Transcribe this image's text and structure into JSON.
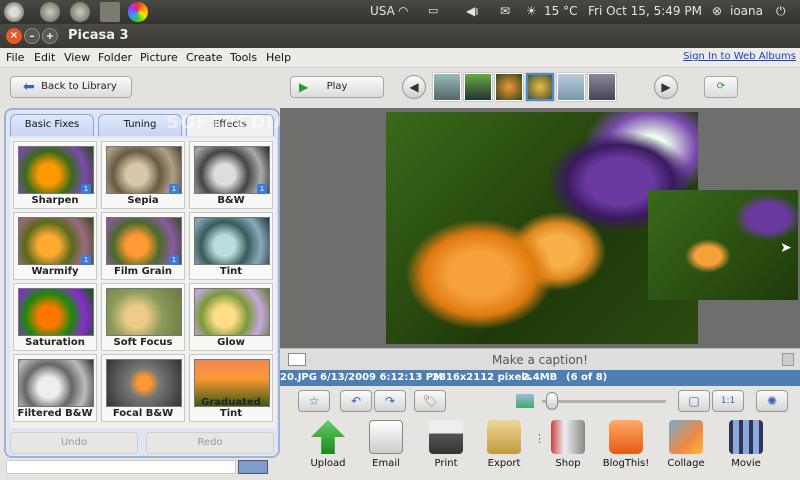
{
  "topbar": {
    "lang": "USA",
    "temp": "15 °C",
    "datetime": "Fri Oct 15,  5:49 PM",
    "user": "ioana"
  },
  "window": {
    "title": "Picasa 3"
  },
  "menu": {
    "items": [
      "File",
      "Edit",
      "View",
      "Folder",
      "Picture",
      "Create",
      "Tools",
      "Help"
    ],
    "signin": "Sign In to Web Albums"
  },
  "toolbar": {
    "back_label": "Back to Library",
    "play_label": "Play"
  },
  "tabs": {
    "basic": "Basic Fixes",
    "tuning": "Tuning",
    "effects": "Effects"
  },
  "watermark": "SOFTPEDIA",
  "effects": [
    {
      "label": "Sharpen",
      "badge": "1"
    },
    {
      "label": "Sepia",
      "badge": "1"
    },
    {
      "label": "B&W",
      "badge": "1"
    },
    {
      "label": "Warmify",
      "badge": "1"
    },
    {
      "label": "Film Grain",
      "badge": "1"
    },
    {
      "label": "Tint",
      "badge": ""
    },
    {
      "label": "Saturation",
      "badge": ""
    },
    {
      "label": "Soft Focus",
      "badge": ""
    },
    {
      "label": "Glow",
      "badge": ""
    },
    {
      "label": "Filtered B&W",
      "badge": ""
    },
    {
      "label": "Focal B&W",
      "badge": ""
    },
    {
      "label": "Graduated Tint",
      "badge": ""
    }
  ],
  "undo_label": "Undo",
  "redo_label": "Redo",
  "caption_placeholder": "Make a caption!",
  "info": {
    "filename": "20.JPG",
    "date": "6/13/2009 6:12:13 PM",
    "dimensions": "2816x2112 pixels",
    "size": "2.4MB",
    "position": "(6 of 8)"
  },
  "zoom_label": "1:1",
  "actions": [
    {
      "label": "Upload",
      "icon": "upload-icon"
    },
    {
      "label": "Email",
      "icon": "email-icon"
    },
    {
      "label": "Print",
      "icon": "print-icon"
    },
    {
      "label": "Export",
      "icon": "export-icon"
    },
    {
      "label": "Shop",
      "icon": "shop-icon"
    },
    {
      "label": "BlogThis!",
      "icon": "blogger-icon"
    },
    {
      "label": "Collage",
      "icon": "collage-icon"
    },
    {
      "label": "Movie",
      "icon": "movie-icon"
    }
  ]
}
